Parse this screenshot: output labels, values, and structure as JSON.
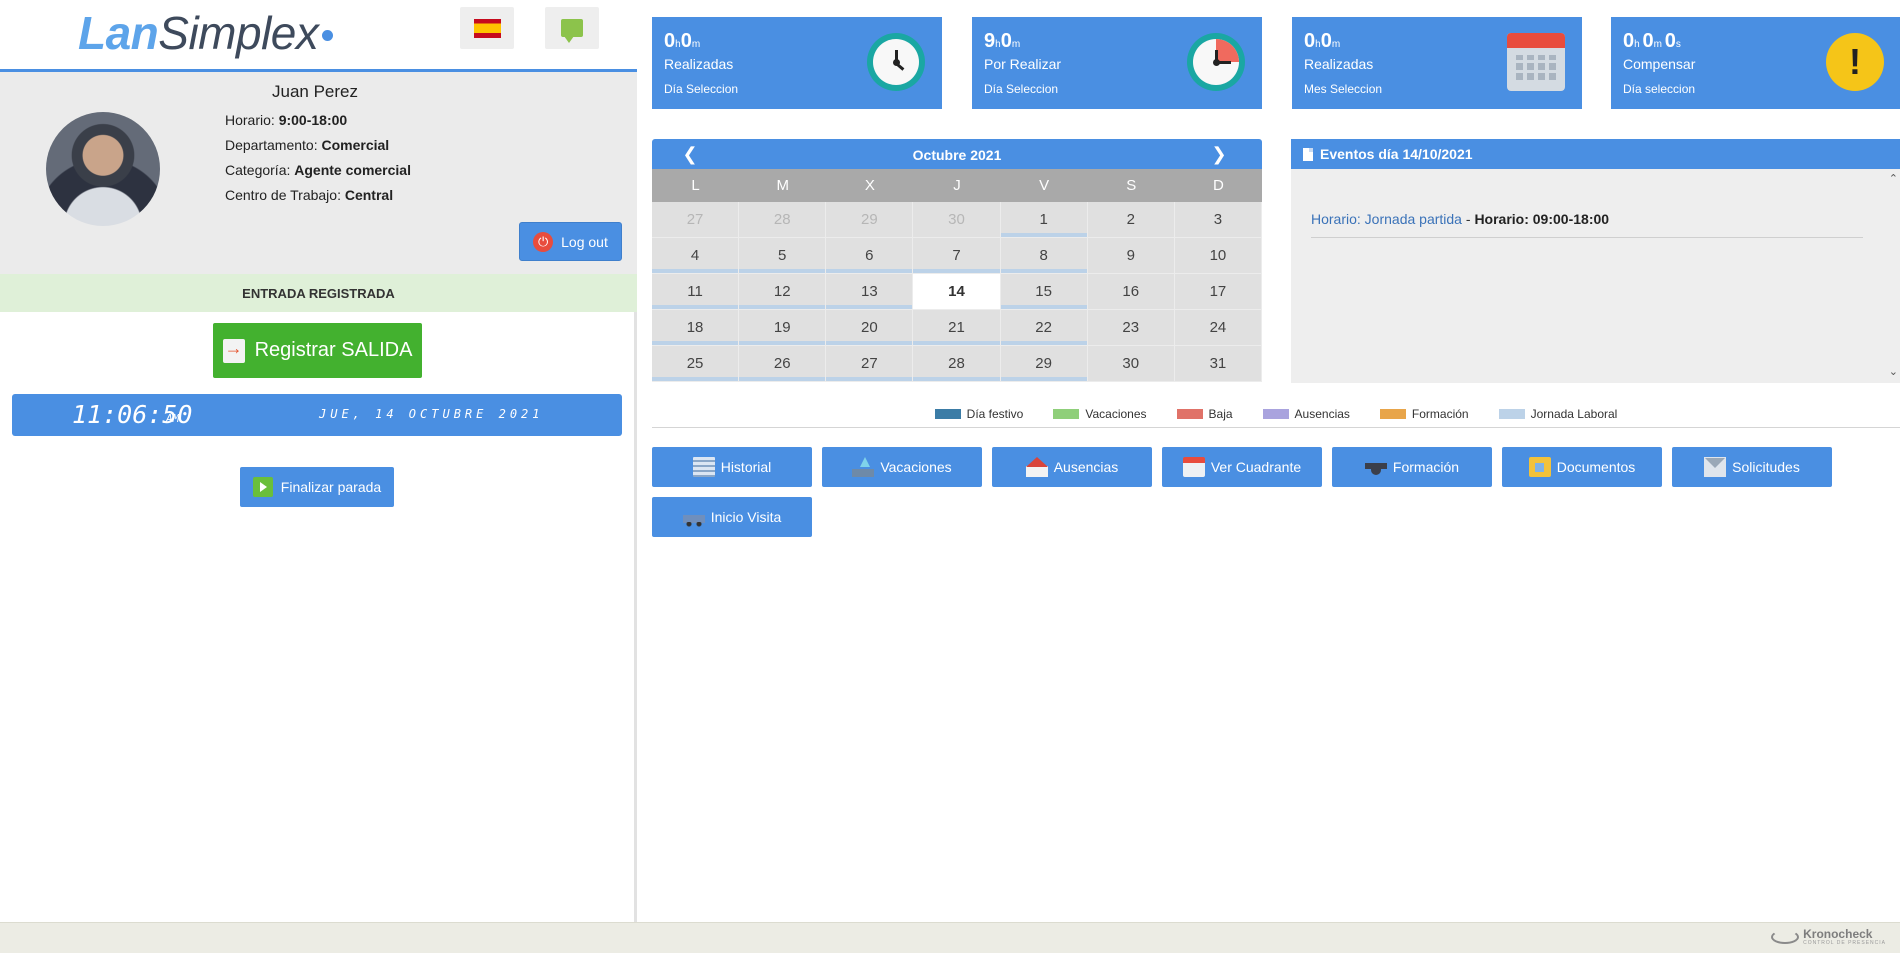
{
  "app": {
    "logo_lan": "Lan",
    "logo_simplex": "Simplex"
  },
  "header": {
    "flag_icon": "spain-flag-icon",
    "chat_icon": "chat-bubble-icon"
  },
  "profile": {
    "name": "Juan Perez",
    "horario_label": "Horario:",
    "horario_value": "9:00-18:00",
    "departamento_label": "Departamento:",
    "departamento_value": "Comercial",
    "categoria_label": "Categoría:",
    "categoria_value": "Agente comercial",
    "centro_label": "Centro de Trabajo:",
    "centro_value": "Central",
    "logout_label": "Log out"
  },
  "status": {
    "text": "ENTRADA REGISTRADA",
    "color": "#dff0d8"
  },
  "actions_left": {
    "registrar_label": "Registrar SALIDA",
    "finalizar_label": "Finalizar parada"
  },
  "clock": {
    "time": "11:06:50",
    "ampm": "AM",
    "date": "JUE, 14 OCTUBRE 2021"
  },
  "stats": [
    {
      "num1": "0",
      "u1": "h",
      "num2": "0",
      "u2": "m",
      "num3": "",
      "u3": "",
      "label": "Realizadas",
      "sub": "Día Seleccion",
      "icon": "clock-icon"
    },
    {
      "num1": "9",
      "u1": "h",
      "num2": "0",
      "u2": "m",
      "num3": "",
      "u3": "",
      "label": "Por Realizar",
      "sub": "Día Seleccion",
      "icon": "clock-red-icon"
    },
    {
      "num1": "0",
      "u1": "h",
      "num2": "0",
      "u2": "m",
      "num3": "",
      "u3": "",
      "label": "Realizadas",
      "sub": "Mes Seleccion",
      "icon": "calendar-icon"
    },
    {
      "num1": "0",
      "u1": "h ",
      "num2": "0",
      "u2": "m ",
      "num3": "0",
      "u3": "s",
      "label": "Compensar",
      "sub": "Día seleccion",
      "icon": "warning-icon"
    }
  ],
  "calendar": {
    "title": "Octubre 2021",
    "prev": "❮",
    "next": "❯",
    "weekdays": [
      "L",
      "M",
      "X",
      "J",
      "V",
      "S",
      "D"
    ],
    "weeks": [
      [
        "27",
        "28",
        "29",
        "30",
        "1",
        "2",
        "3"
      ],
      [
        "4",
        "5",
        "6",
        "7",
        "8",
        "9",
        "10"
      ],
      [
        "11",
        "12",
        "13",
        "14",
        "15",
        "16",
        "17"
      ],
      [
        "18",
        "19",
        "20",
        "21",
        "22",
        "23",
        "24"
      ],
      [
        "25",
        "26",
        "27",
        "28",
        "29",
        "30",
        "31"
      ]
    ],
    "today": "14"
  },
  "events": {
    "title": "Eventos día 14/10/2021",
    "item_label": "Horario: Jornada partida",
    "item_sep": " - ",
    "item_value": "Horario: 09:00-18:00"
  },
  "legend": [
    {
      "label": "Día festivo",
      "color": "#3b7ca6"
    },
    {
      "label": "Vacaciones",
      "color": "#8fcf7a"
    },
    {
      "label": "Baja",
      "color": "#e07268"
    },
    {
      "label": "Ausencias",
      "color": "#a9a3de"
    },
    {
      "label": "Formación",
      "color": "#e8a54a"
    },
    {
      "label": "Jornada Laboral",
      "color": "#bcd2e8"
    }
  ],
  "buttons": [
    {
      "label": "Historial",
      "icon": "history-icon"
    },
    {
      "label": "Vacaciones",
      "icon": "vacation-icon"
    },
    {
      "label": "Ausencias",
      "icon": "house-icon"
    },
    {
      "label": "Ver Cuadrante",
      "icon": "calendar-icon"
    },
    {
      "label": "Formación",
      "icon": "graduation-cap-icon"
    },
    {
      "label": "Documentos",
      "icon": "folder-icon"
    },
    {
      "label": "Solicitudes",
      "icon": "mail-icon"
    },
    {
      "label": "Inicio Visita",
      "icon": "car-icon"
    }
  ],
  "footer": {
    "brand": "Kronocheck",
    "tagline": "CONTROL DE PRESENCIA"
  },
  "colors": {
    "accent": "#4a8fe2",
    "success": "#43b12f"
  }
}
